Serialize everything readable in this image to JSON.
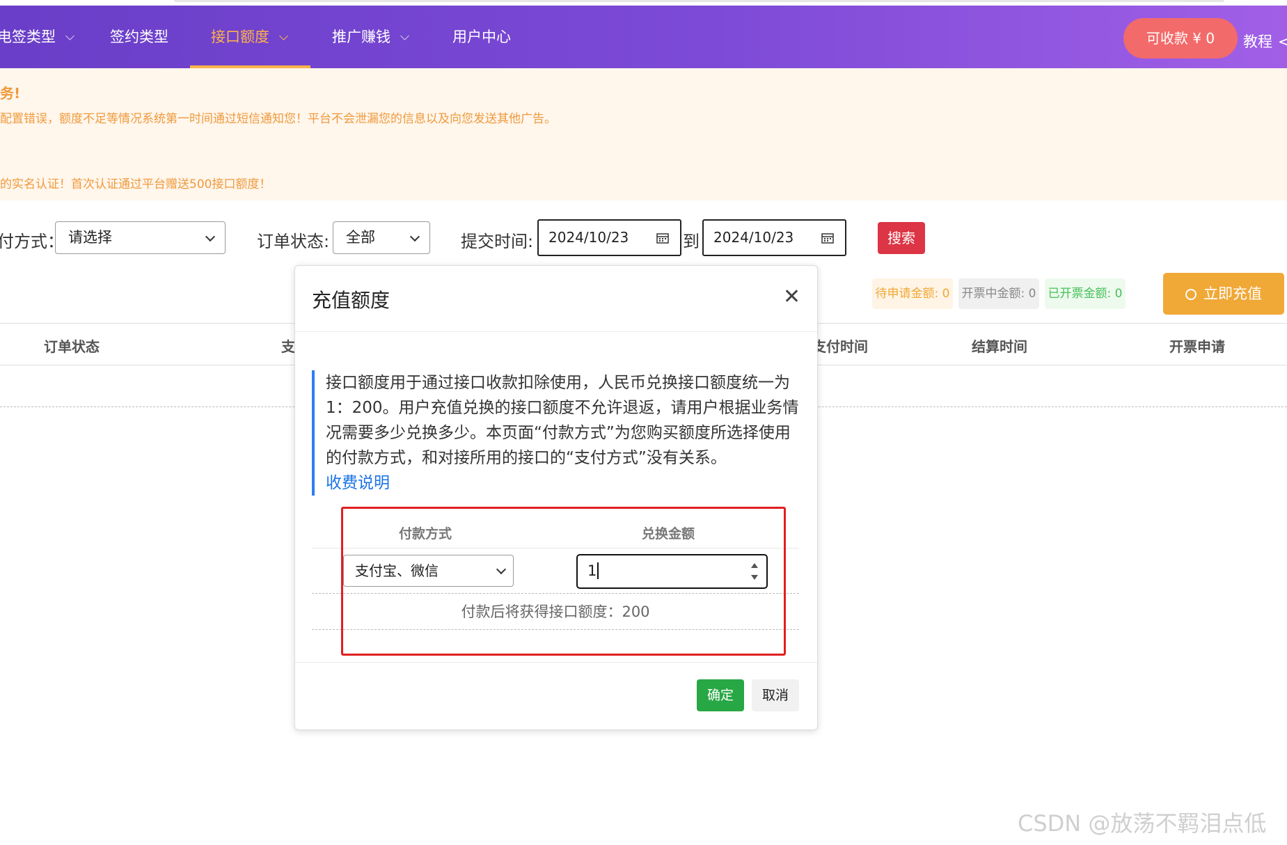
{
  "nav": {
    "items": [
      {
        "label": "电签类型",
        "active": false,
        "has_dropdown": true
      },
      {
        "label": "签约类型",
        "active": false,
        "has_dropdown": false
      },
      {
        "label": "接口额度",
        "active": true,
        "has_dropdown": true
      },
      {
        "label": "推广赚钱",
        "active": false,
        "has_dropdown": true
      },
      {
        "label": "用户中心",
        "active": false,
        "has_dropdown": false
      }
    ],
    "collect_button": "可收款 ¥ 0",
    "tutorial": "教程",
    "active_color": "#ffb24a"
  },
  "notice": {
    "title": "务!",
    "line1": "配置错误，额度不足等情况系统第一时间通过短信通知您！平台不会泄漏您的信息以及向您发送其他广告。",
    "line2": "的实名认证！首次认证通过平台赠送500接口额度！"
  },
  "filters": {
    "pay_method_label": "付方式：",
    "pay_method_value": "请选择",
    "order_status_label": "订单状态:",
    "order_status_value": "全部",
    "submit_time_label": "提交时间:",
    "date_from": "2024/10/23",
    "to_label": "到",
    "date_to": "2024/10/23",
    "search_button": "搜索"
  },
  "badges": {
    "pending": "待申请金额: 0",
    "invoicing": "开票中金额: 0",
    "invoiced": "已开票金额: 0"
  },
  "recharge_button": "立即充值",
  "table_headers": [
    "订单状态",
    "支",
    "支付时间",
    "结算时间",
    "开票申请"
  ],
  "modal": {
    "title": "充值额度",
    "description": "接口额度用于通过接口收款扣除使用，人民币兑换接口额度统一为1：200。用户充值兑换的接口额度不允许退返，请用户根据业务情况需要多少兑换多少。本页面“付款方式”为您购买额度所选择使用的付款方式，和对接所用的接口的“支付方式”没有关系。",
    "fee_link": "收费说明",
    "col_payment": "付款方式",
    "col_amount": "兑换金额",
    "payment_value": "支付宝、微信",
    "amount_value": "1",
    "result": "付款后将获得接口额度：200",
    "confirm": "确定",
    "cancel": "取消"
  },
  "watermark": "CSDN @放荡不羁泪点低",
  "colors": {
    "nav_start": "#6a3ec8",
    "nav_end": "#a15fe6",
    "collect": "#f36a6a",
    "notice_text": "#ef9a3c",
    "search": "#dc3545",
    "recharge": "#f0a836",
    "confirm": "#28a745",
    "highlight": "#e01f1f",
    "link": "#1a73e8"
  }
}
